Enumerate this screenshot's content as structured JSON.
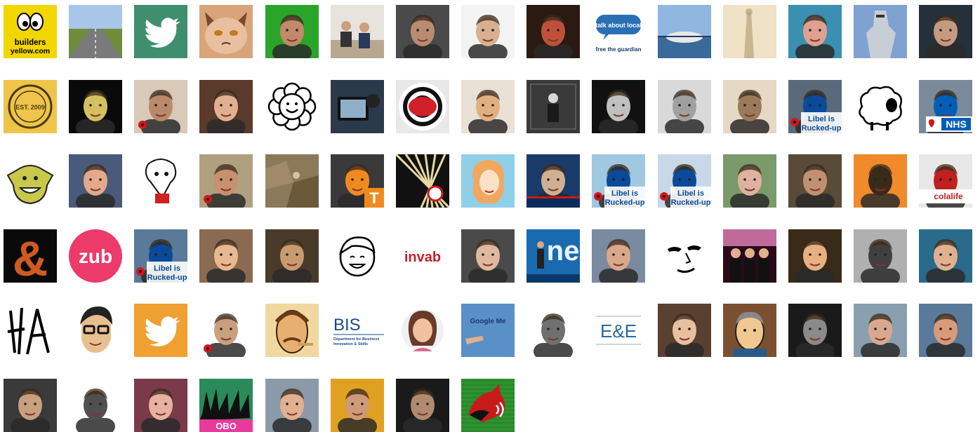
{
  "avatars": [
    {
      "kind": "buildersyellow",
      "bg": "#f2d600",
      "fg": "#000000",
      "text": "builders\nyellow.com"
    },
    {
      "kind": "road",
      "bg": "#a8c7e8",
      "fg": "#6f8c3b"
    },
    {
      "kind": "twitter",
      "bg": "#3f8f6f",
      "fg": "#ffffff"
    },
    {
      "kind": "cat",
      "bg": "#d9a47a",
      "fg": "#7a4a2a"
    },
    {
      "kind": "face",
      "bg": "#2aa52a",
      "fg": "#c28a6a"
    },
    {
      "kind": "room",
      "bg": "#e8e3dc",
      "fg": "#333333"
    },
    {
      "kind": "face",
      "bg": "#4a4a4a",
      "fg": "#b88c70"
    },
    {
      "kind": "face",
      "bg": "#f3f3f3",
      "fg": "#d8b090"
    },
    {
      "kind": "face",
      "bg": "#2a1a12",
      "fg": "#c0503a"
    },
    {
      "kind": "talkaboutlocal",
      "bg": "#ffffff",
      "fg": "#2a6fb3",
      "text": "talk about local",
      "text2": "free the guardian"
    },
    {
      "kind": "landscape",
      "bg": "#8fb7df",
      "fg": "#203d6a"
    },
    {
      "kind": "shadow",
      "bg": "#efe2c6",
      "fg": "#b8a27a"
    },
    {
      "kind": "face",
      "bg": "#3b8fb0",
      "fg": "#e0a090"
    },
    {
      "kind": "knight",
      "bg": "#7fa2d0",
      "fg": "#c8ced6"
    },
    {
      "kind": "face",
      "bg": "#26303a",
      "fg": "#c59a80"
    },
    {
      "kind": "stamp",
      "bg": "#eec44a",
      "fg": "#4a3a10",
      "text": "EST. 2009"
    },
    {
      "kind": "face",
      "bg": "#0a0a0a",
      "fg": "#d4c060"
    },
    {
      "kind": "poppyface",
      "bg": "#d8c9b8",
      "fg": "#b98a6a"
    },
    {
      "kind": "face",
      "bg": "#5a3a2a",
      "fg": "#e2b090"
    },
    {
      "kind": "flower",
      "bg": "#ffffff",
      "fg": "#cc2a20"
    },
    {
      "kind": "camera",
      "bg": "#2a3a4a",
      "fg": "#8fb0c8"
    },
    {
      "kind": "target",
      "bg": "#e8e8e8",
      "fg": "#d0202a"
    },
    {
      "kind": "face",
      "bg": "#e9e1d5",
      "fg": "#e0b080"
    },
    {
      "kind": "bw",
      "bg": "#3a3a3a",
      "fg": "#d8d8d8"
    },
    {
      "kind": "face",
      "bg": "#111111",
      "fg": "#c0c0c0"
    },
    {
      "kind": "face",
      "bg": "#d9d9d9",
      "fg": "#a0a0a0"
    },
    {
      "kind": "face",
      "bg": "#e6d8c4",
      "fg": "#9a7a5a"
    },
    {
      "kind": "libel",
      "bg": "#5a6a7a",
      "fg": "#0b4a9a",
      "text": "Libel is",
      "text2": "Rucked-up"
    },
    {
      "kind": "sheep",
      "bg": "#ffffff",
      "fg": "#000000"
    },
    {
      "kind": "nhs",
      "bg": "#7a8a9a",
      "fg": "#005eb8",
      "text": "NHS"
    },
    {
      "kind": "monster",
      "bg": "#ffffff",
      "fg": "#c8c84a"
    },
    {
      "kind": "face",
      "bg": "#4a5a7a",
      "fg": "#e2a98a"
    },
    {
      "kind": "cartoon",
      "bg": "#ffffff",
      "fg": "#d02020"
    },
    {
      "kind": "poppyface",
      "bg": "#b0a080",
      "fg": "#c89070"
    },
    {
      "kind": "rocks",
      "bg": "#8a7a5a",
      "fg": "#d8c0a0"
    },
    {
      "kind": "tbadge",
      "bg": "#3a3a3a",
      "fg": "#f08a20",
      "text": "T"
    },
    {
      "kind": "lines",
      "bg": "#111111",
      "fg": "#e8d8a0"
    },
    {
      "kind": "retro",
      "bg": "#8fd0e8",
      "fg": "#f0a860"
    },
    {
      "kind": "news",
      "bg": "#1a3a6a",
      "fg": "#d0b090"
    },
    {
      "kind": "libel",
      "bg": "#a0c8e0",
      "fg": "#0b4a9a",
      "text": "Libel is",
      "text2": "Rucked-up"
    },
    {
      "kind": "libel",
      "bg": "#c8d8e8",
      "fg": "#0b4a9a",
      "text": "Libel is",
      "text2": "Rucked-up"
    },
    {
      "kind": "face",
      "bg": "#7a9a6a",
      "fg": "#e0b0a0"
    },
    {
      "kind": "face",
      "bg": "#5a4a3a",
      "fg": "#c09070"
    },
    {
      "kind": "face",
      "bg": "#f08a2a",
      "fg": "#3a2a1a"
    },
    {
      "kind": "colalife",
      "bg": "#e8e8e8",
      "fg": "#c02020",
      "text": "colalife"
    },
    {
      "kind": "ampersand",
      "bg": "#0a0a0a",
      "fg": "#d05a20",
      "text": "&"
    },
    {
      "kind": "zub",
      "bg": "#ffffff",
      "fg": "#ec3a6a",
      "text": "zub"
    },
    {
      "kind": "libel",
      "bg": "#5a7a9a",
      "fg": "#0b4a9a",
      "text": "Libel is",
      "text2": "Rucked-up"
    },
    {
      "kind": "face",
      "bg": "#8a6a50",
      "fg": "#e8b890"
    },
    {
      "kind": "face",
      "bg": "#4a3a2a",
      "fg": "#c89a70"
    },
    {
      "kind": "kid",
      "bg": "#ffffff",
      "fg": "#000000"
    },
    {
      "kind": "invab",
      "bg": "#ffffff",
      "fg": "#c81f2a",
      "text": "invab"
    },
    {
      "kind": "face",
      "bg": "#4a4a4a",
      "fg": "#e0b8a0"
    },
    {
      "kind": "stage",
      "bg": "#1a6ab0",
      "fg": "#ffffff"
    },
    {
      "kind": "face",
      "bg": "#7a8aa0",
      "fg": "#d8a888"
    },
    {
      "kind": "silhouette",
      "bg": "#ffffff",
      "fg": "#000000"
    },
    {
      "kind": "band",
      "bg": "#2a0a1a",
      "fg": "#c06a9a"
    },
    {
      "kind": "face",
      "bg": "#3a2a1a",
      "fg": "#e8b080"
    },
    {
      "kind": "face",
      "bg": "#b0b0b0",
      "fg": "#404040"
    },
    {
      "kind": "face",
      "bg": "#2a6a8a",
      "fg": "#e0b090"
    },
    {
      "kind": "ha",
      "bg": "#ffffff",
      "fg": "#000000",
      "text": "HA"
    },
    {
      "kind": "glasses",
      "bg": "#ffffff",
      "fg": "#000000"
    },
    {
      "kind": "twitter",
      "bg": "#f0a030",
      "fg": "#ffffff"
    },
    {
      "kind": "poppyface",
      "bg": "#ffffff",
      "fg": "#c8a080"
    },
    {
      "kind": "caricature",
      "bg": "#f0d8a0",
      "fg": "#6a3a1a"
    },
    {
      "kind": "bis",
      "bg": "#ffffff",
      "fg": "#1a4a8a",
      "text": "BIS",
      "text2": "Department for Business",
      "text3": "Innovation & Skills"
    },
    {
      "kind": "womanround",
      "bg": "#ffffff",
      "fg": "#d86a8a"
    },
    {
      "kind": "googleme",
      "bg": "#5a90c8",
      "fg": "#1a3a6a",
      "text": "Google Me"
    },
    {
      "kind": "face",
      "bg": "#ffffff",
      "fg": "#707070"
    },
    {
      "kind": "ee",
      "bg": "#ffffff",
      "fg": "#2a6aa0",
      "text": "E&E"
    },
    {
      "kind": "face",
      "bg": "#5a4030",
      "fg": "#e8c0a0"
    },
    {
      "kind": "cartoonman",
      "bg": "#7a5030",
      "fg": "#f0c890"
    },
    {
      "kind": "face",
      "bg": "#1a1a1a",
      "fg": "#8a8a8a"
    },
    {
      "kind": "face",
      "bg": "#8aa0b0",
      "fg": "#d8a890"
    },
    {
      "kind": "face",
      "bg": "#5a7a9a",
      "fg": "#d89a78"
    },
    {
      "kind": "face",
      "bg": "#3a3a3a",
      "fg": "#c8a080"
    },
    {
      "kind": "face",
      "bg": "#ffffff",
      "fg": "#505050"
    },
    {
      "kind": "face",
      "bg": "#7a3a4a",
      "fg": "#e8b0a0"
    },
    {
      "kind": "hands",
      "bg": "#2a8a5a",
      "fg": "#101010",
      "text": "OBO"
    },
    {
      "kind": "face",
      "bg": "#8a9aa8",
      "fg": "#e0b090"
    },
    {
      "kind": "face",
      "bg": "#e0a020",
      "fg": "#d09a78"
    },
    {
      "kind": "face",
      "bg": "#1a1a1a",
      "fg": "#b08a70"
    },
    {
      "kind": "fox",
      "bg": "#2a8a2a",
      "fg": "#c81a1a"
    }
  ]
}
